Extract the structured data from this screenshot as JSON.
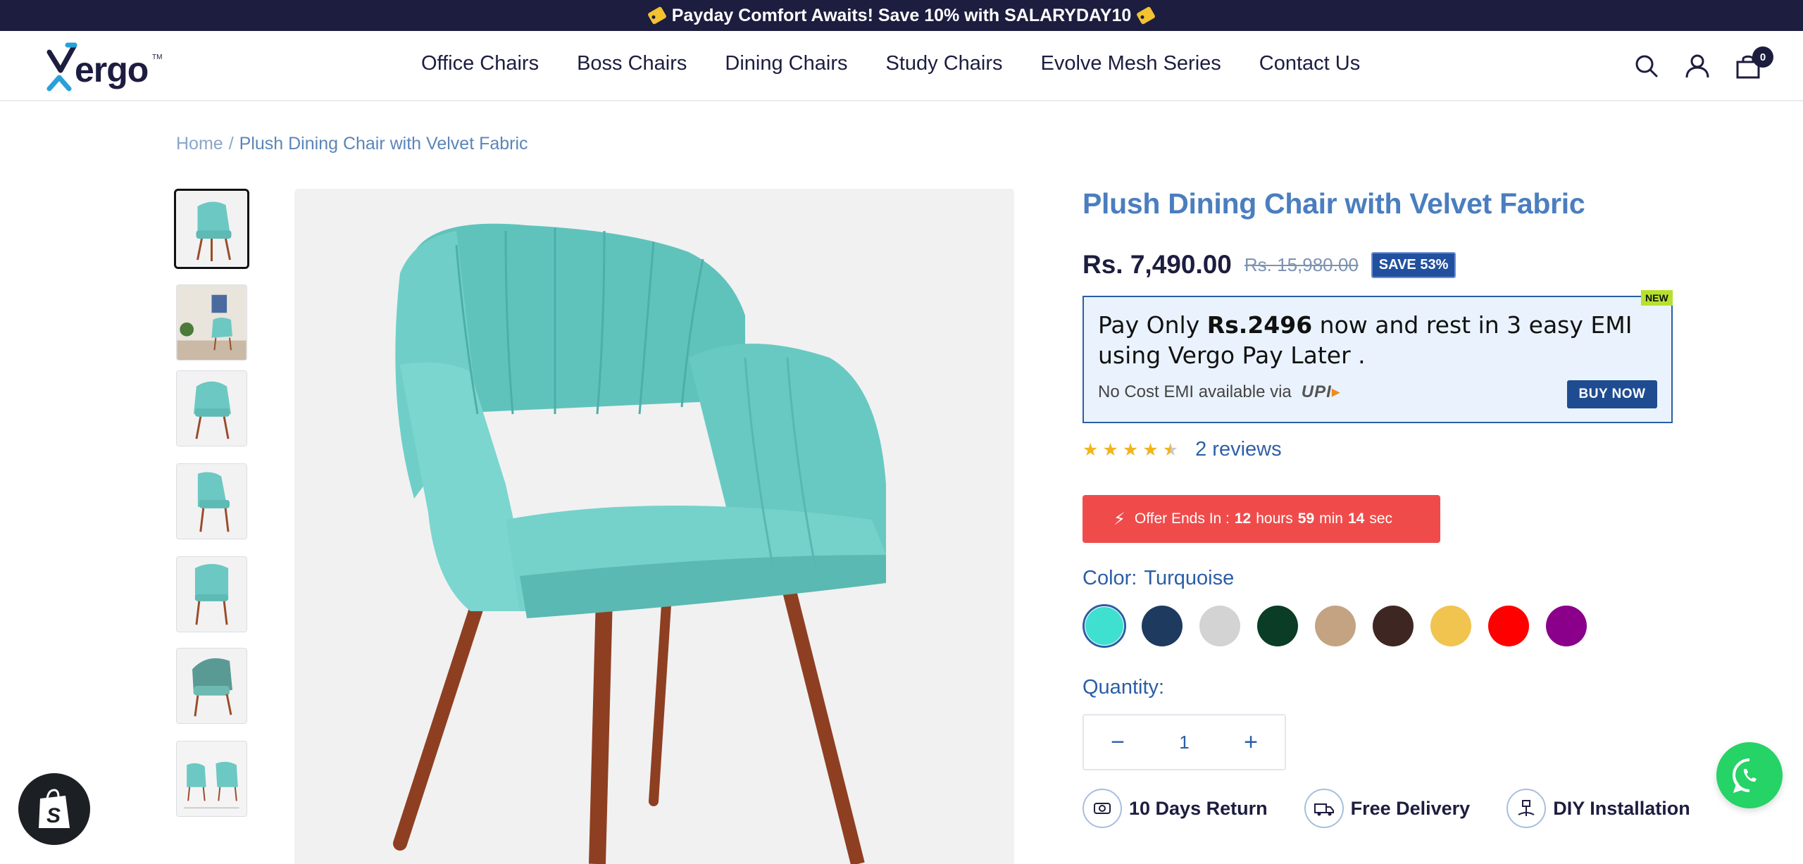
{
  "announcement": {
    "text": "Payday Comfort Awaits! Save 10% with SALARYDAY10"
  },
  "header": {
    "logo_text": "ergo",
    "logo_tm": "TM",
    "nav": [
      "Office Chairs",
      "Boss Chairs",
      "Dining Chairs",
      "Study Chairs",
      "Evolve Mesh Series",
      "Contact Us"
    ],
    "cart_count": "0"
  },
  "breadcrumb": {
    "home": "Home",
    "separator": "/",
    "current": "Plush Dining Chair with Velvet Fabric"
  },
  "product": {
    "title": "Plush Dining Chair with Velvet Fabric",
    "price": "Rs. 7,490.00",
    "compare_price": "Rs. 15,980.00",
    "save_badge": "SAVE 53%",
    "thumbnail_count": 7
  },
  "emi": {
    "line1_prefix": "Pay Only ",
    "line1_amount": "Rs.2496",
    "line1_suffix": " now and rest in 3 easy EMI",
    "line2": "using Vergo Pay Later .",
    "sub_text": "No Cost EMI available via",
    "upi_label": "UPI",
    "buy_now_label": "BUY NOW",
    "new_badge": "NEW"
  },
  "rating": {
    "value": 4.5,
    "reviews_label": "2 reviews"
  },
  "offer": {
    "prefix": "Offer Ends In :",
    "hours": "12",
    "hours_label": "hours",
    "minutes": "59",
    "minutes_label": "min",
    "seconds": "14",
    "seconds_label": "sec"
  },
  "color": {
    "label": "Color:",
    "selected": "Turquoise",
    "options": [
      {
        "name": "Turquoise",
        "hex": "#40e0d0"
      },
      {
        "name": "Navy",
        "hex": "#1f3a5f"
      },
      {
        "name": "Light Grey",
        "hex": "#d3d3d3"
      },
      {
        "name": "Dark Green",
        "hex": "#0b3d26"
      },
      {
        "name": "Beige",
        "hex": "#c4a383"
      },
      {
        "name": "Dark Brown",
        "hex": "#3e2722"
      },
      {
        "name": "Mustard",
        "hex": "#f0c44f"
      },
      {
        "name": "Red",
        "hex": "#ff0000"
      },
      {
        "name": "Purple",
        "hex": "#8b008b"
      }
    ]
  },
  "quantity": {
    "label": "Quantity:",
    "value": "1",
    "minus": "−",
    "plus": "+"
  },
  "perks": [
    "10 Days Return",
    "Free Delivery",
    "DIY Installation"
  ],
  "colors": {
    "navy": "#1c1d3f",
    "accent_blue": "#4a7ebf",
    "offer_red": "#f04b4b",
    "whatsapp": "#25d366"
  }
}
